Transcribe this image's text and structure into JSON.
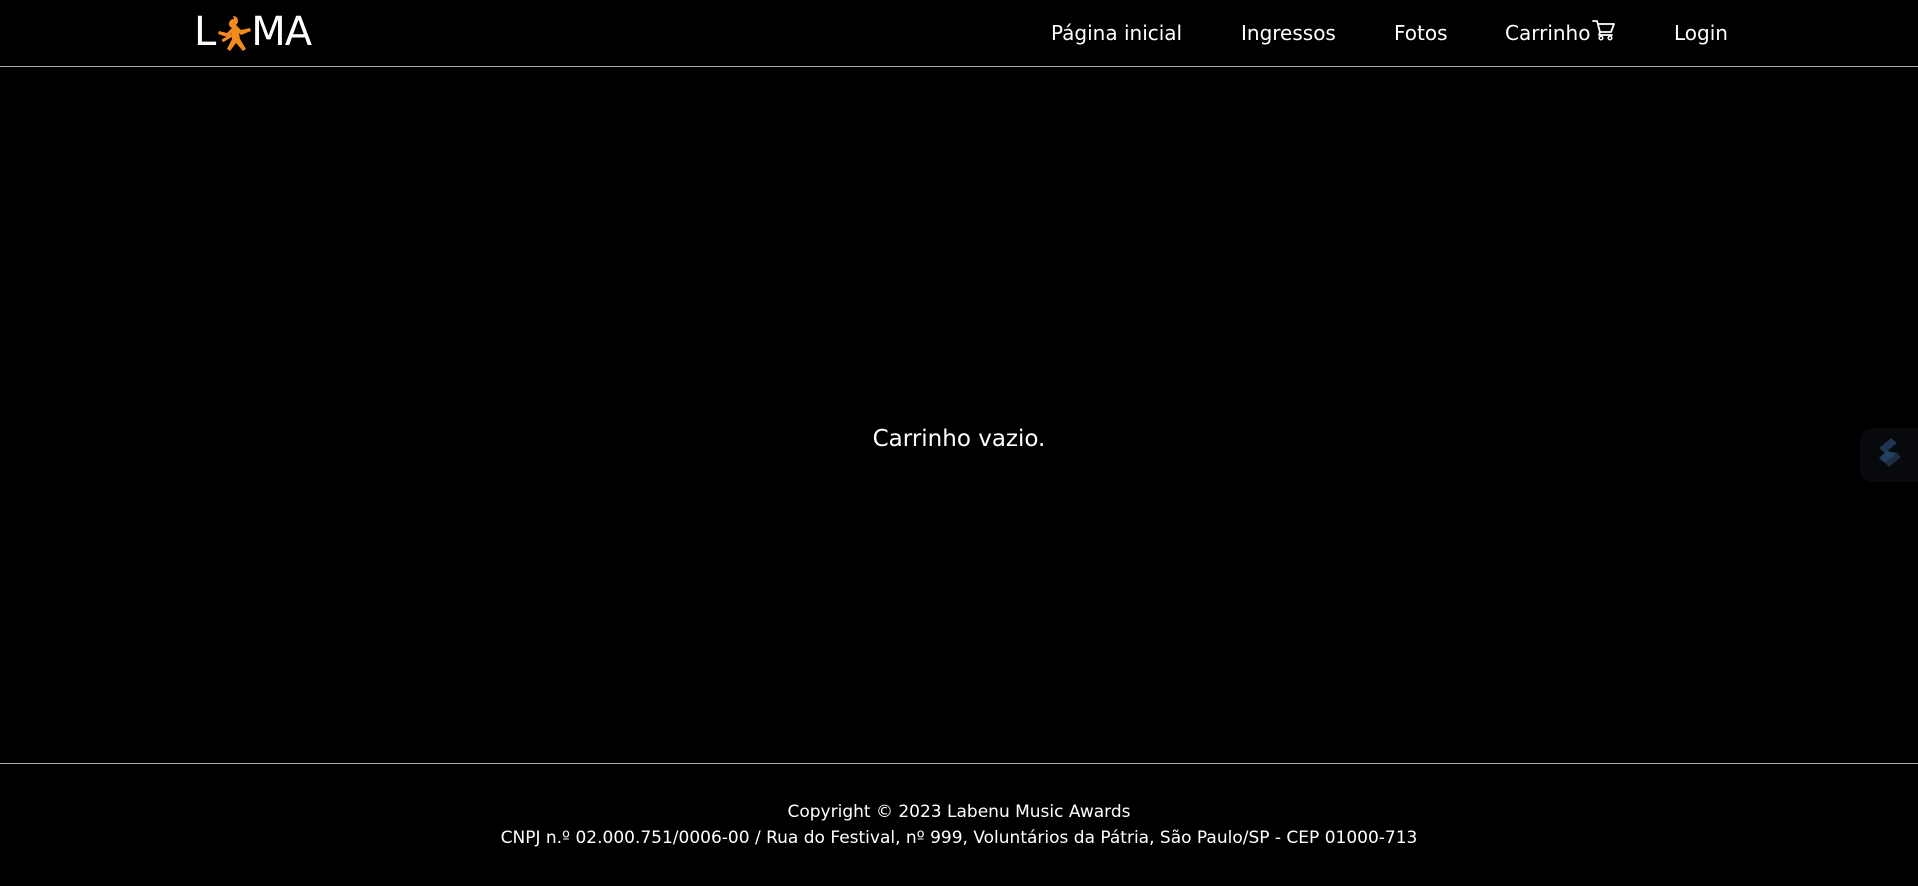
{
  "header": {
    "logo_text_start": "L",
    "logo_text_end": "MA",
    "logo_icon": "jumping-guitarist-icon",
    "nav": {
      "home": "Página inicial",
      "tickets": "Ingressos",
      "photos": "Fotos",
      "cart": "Carrinho",
      "cart_icon": "shopping-cart-icon",
      "login": "Login"
    }
  },
  "main": {
    "empty_cart_message": "Carrinho vazio."
  },
  "side_widget": {
    "icon": "stacked-slash-icon"
  },
  "footer": {
    "copyright": "Copyright © 2023 Labenu Music Awards",
    "address": "CNPJ n.º 02.000.751/0006-00 / Rua do Festival, nº 999, Voluntários da Pátria, São Paulo/SP - CEP 01000-713"
  },
  "colors": {
    "background": "#000000",
    "text": "#ffffff",
    "accent": "#f28b1e",
    "divider": "#a9a9a9"
  }
}
